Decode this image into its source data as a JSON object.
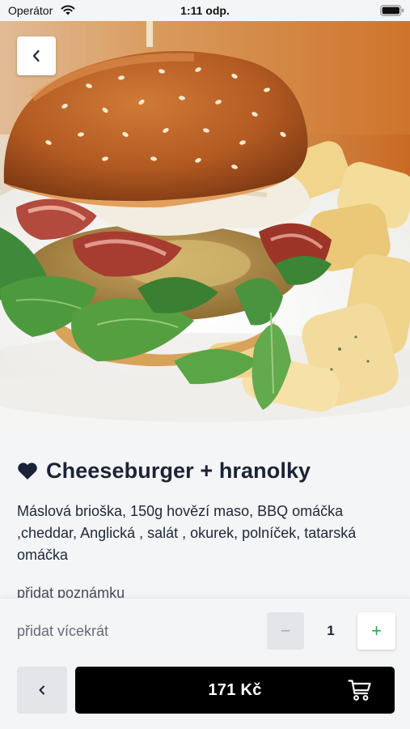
{
  "status_bar": {
    "carrier": "Operátor",
    "time": "1:11 odp.",
    "icons": [
      "wifi-icon",
      "battery-icon"
    ]
  },
  "hero": {
    "image": "cheeseburger-with-fries-photo",
    "back_icon": "chevron-left-icon"
  },
  "product": {
    "favorite_icon": "heart-icon",
    "title": "Cheeseburger + hranolky",
    "description": "Máslová brioška, 150g hovězí maso, BBQ omáčka ,cheddar, Anglická , salát , okurek, polníček, tatarská omáčka",
    "note_link": "přidat poznámku"
  },
  "order": {
    "repeat_label": "přidat vícekrát",
    "minus_symbol": "−",
    "quantity": "1",
    "plus_symbol": "+",
    "price": "171 Kč",
    "back_icon": "chevron-left-icon",
    "cart_icon": "cart-icon"
  },
  "colors": {
    "background": "#f4f5f7",
    "title": "#1b2436",
    "plus_accent": "#2ea34a",
    "cart_button": "#000000"
  }
}
